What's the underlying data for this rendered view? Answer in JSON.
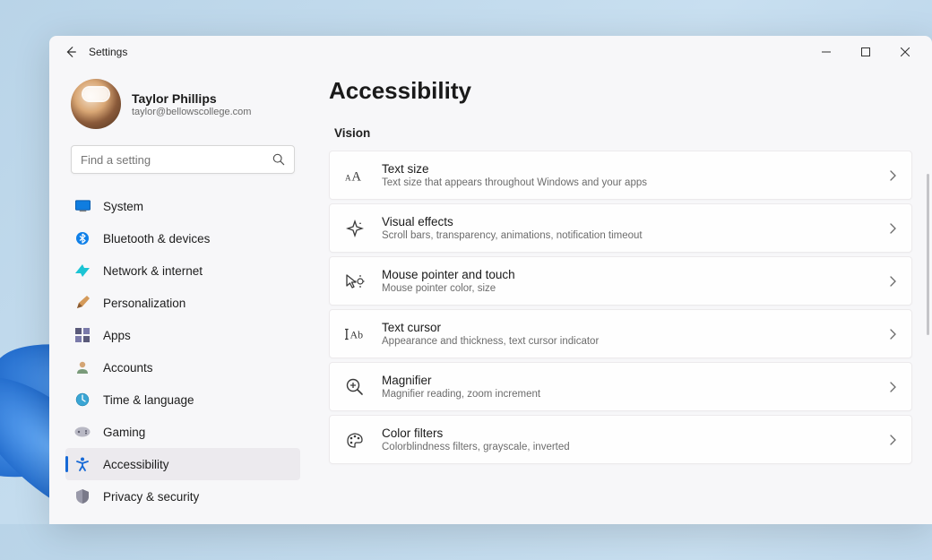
{
  "window": {
    "title": "Settings"
  },
  "profile": {
    "name": "Taylor Phillips",
    "email": "taylor@bellowscollege.com"
  },
  "search": {
    "placeholder": "Find a setting"
  },
  "nav": {
    "items": [
      {
        "label": "System",
        "icon": "system"
      },
      {
        "label": "Bluetooth & devices",
        "icon": "bluetooth"
      },
      {
        "label": "Network & internet",
        "icon": "network"
      },
      {
        "label": "Personalization",
        "icon": "personalization"
      },
      {
        "label": "Apps",
        "icon": "apps"
      },
      {
        "label": "Accounts",
        "icon": "accounts"
      },
      {
        "label": "Time & language",
        "icon": "time"
      },
      {
        "label": "Gaming",
        "icon": "gaming"
      },
      {
        "label": "Accessibility",
        "icon": "accessibility",
        "selected": true
      },
      {
        "label": "Privacy & security",
        "icon": "privacy"
      }
    ]
  },
  "page": {
    "title": "Accessibility",
    "section": "Vision",
    "cards": [
      {
        "title": "Text size",
        "sub": "Text size that appears throughout Windows and your apps"
      },
      {
        "title": "Visual effects",
        "sub": "Scroll bars, transparency, animations, notification timeout"
      },
      {
        "title": "Mouse pointer and touch",
        "sub": "Mouse pointer color, size"
      },
      {
        "title": "Text cursor",
        "sub": "Appearance and thickness, text cursor indicator"
      },
      {
        "title": "Magnifier",
        "sub": "Magnifier reading, zoom increment"
      },
      {
        "title": "Color filters",
        "sub": "Colorblindness filters, grayscale, inverted"
      }
    ]
  }
}
